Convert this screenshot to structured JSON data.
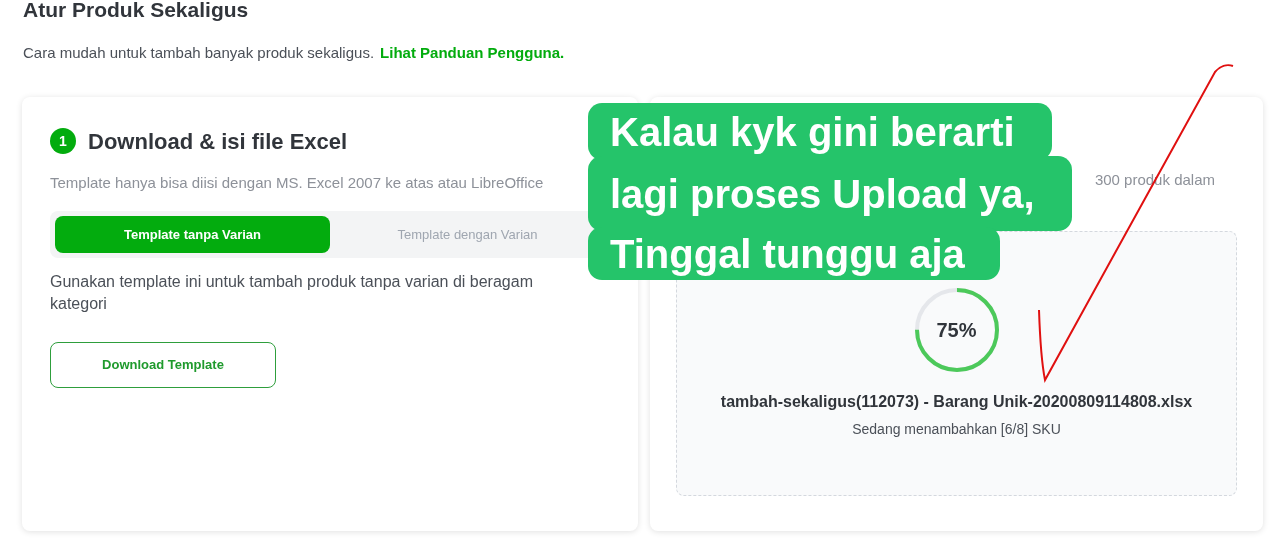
{
  "page": {
    "title": "Atur Produk Sekaligus",
    "subtitle": "Cara mudah untuk tambah banyak produk sekaligus.",
    "guide_link": "Lihat Panduan Pengguna."
  },
  "download_card": {
    "step": "1",
    "title": "Download & isi file Excel",
    "description": "Template hanya bisa diisi dengan MS. Excel 2007 ke atas atau LibreOffice",
    "tabs": [
      {
        "label": "Template tanpa Varian",
        "selected": true
      },
      {
        "label": "Template dengan Varian",
        "selected": false
      }
    ],
    "tab_description": "Gunakan template ini untuk tambah produk tanpa varian di beragam kategori",
    "button": "Download Template"
  },
  "upload_card": {
    "description_visible_part": "300 produk dalam",
    "upload": {
      "percent": "75%",
      "file_name": "tambah-sekaligus(112073) - Barang Unik-20200809114808.xlsx",
      "status": "Sedang menambahkan [6/8] SKU"
    }
  },
  "annotation": {
    "lines": [
      "Kalau kyk gini berarti",
      "lagi proses Upload ya,",
      "Tinggal tunggu aja"
    ]
  }
}
